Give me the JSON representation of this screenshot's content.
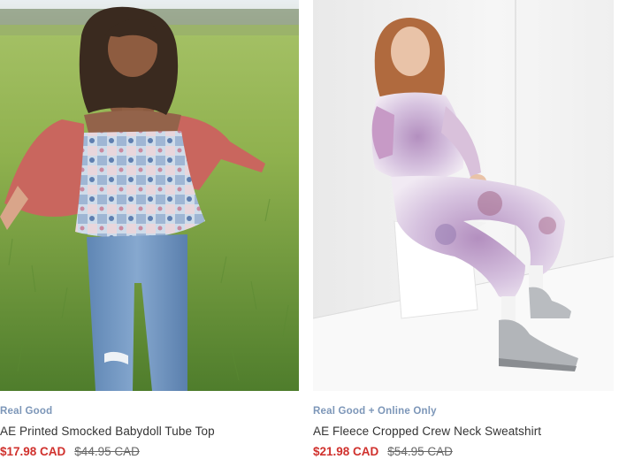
{
  "products": [
    {
      "tag": "Real Good",
      "name": "AE Printed Smocked Babydoll Tube Top",
      "sale_price": "$17.98 CAD",
      "original_price": "$44.95 CAD"
    },
    {
      "tag": "Real Good + Online Only",
      "name": "AE Fleece Cropped Crew Neck Sweatshirt",
      "sale_price": "$21.98 CAD",
      "original_price": "$54.95 CAD"
    }
  ],
  "colors": {
    "tag": "#7c96b8",
    "sale": "#d0312d",
    "name": "#333333"
  }
}
